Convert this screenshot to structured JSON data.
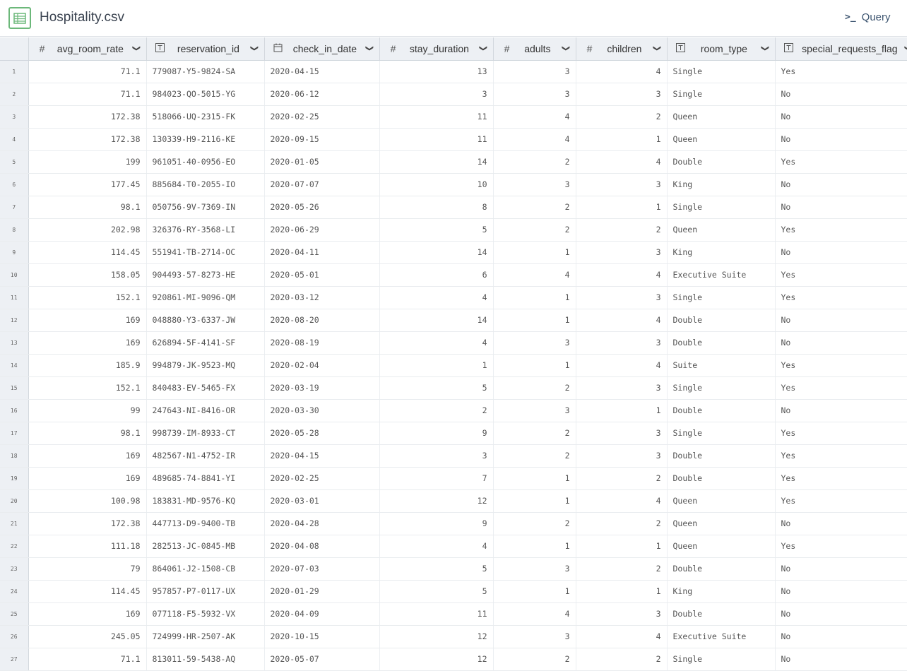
{
  "app": {
    "title": "Hospitality.csv",
    "query_label": "Query"
  },
  "columns": [
    {
      "name": "avg_room_rate",
      "type": "number",
      "icon": "#"
    },
    {
      "name": "reservation_id",
      "type": "text",
      "icon": "T"
    },
    {
      "name": "check_in_date",
      "type": "date",
      "icon": "📅"
    },
    {
      "name": "stay_duration",
      "type": "number",
      "icon": "#"
    },
    {
      "name": "adults",
      "type": "number",
      "icon": "#"
    },
    {
      "name": "children",
      "type": "number",
      "icon": "#"
    },
    {
      "name": "room_type",
      "type": "text",
      "icon": "T"
    },
    {
      "name": "special_requests_flag",
      "type": "text",
      "icon": "T"
    }
  ],
  "rows": [
    [
      "1",
      "71.1",
      "779087-Y5-9824-SA",
      "2020-04-15",
      "13",
      "3",
      "4",
      "Single",
      "Yes"
    ],
    [
      "2",
      "71.1",
      "984023-QO-5015-YG",
      "2020-06-12",
      "3",
      "3",
      "3",
      "Single",
      "No"
    ],
    [
      "3",
      "172.38",
      "518066-UQ-2315-FK",
      "2020-02-25",
      "11",
      "4",
      "2",
      "Queen",
      "No"
    ],
    [
      "4",
      "172.38",
      "130339-H9-2116-KE",
      "2020-09-15",
      "11",
      "4",
      "1",
      "Queen",
      "No"
    ],
    [
      "5",
      "199",
      "961051-40-0956-EO",
      "2020-01-05",
      "14",
      "2",
      "4",
      "Double",
      "Yes"
    ],
    [
      "6",
      "177.45",
      "885684-T0-2055-IO",
      "2020-07-07",
      "10",
      "3",
      "3",
      "King",
      "No"
    ],
    [
      "7",
      "98.1",
      "050756-9V-7369-IN",
      "2020-05-26",
      "8",
      "2",
      "1",
      "Single",
      "No"
    ],
    [
      "8",
      "202.98",
      "326376-RY-3568-LI",
      "2020-06-29",
      "5",
      "2",
      "2",
      "Queen",
      "Yes"
    ],
    [
      "9",
      "114.45",
      "551941-TB-2714-OC",
      "2020-04-11",
      "14",
      "1",
      "3",
      "King",
      "No"
    ],
    [
      "10",
      "158.05",
      "904493-57-8273-HE",
      "2020-05-01",
      "6",
      "4",
      "4",
      "Executive Suite",
      "Yes"
    ],
    [
      "11",
      "152.1",
      "920861-MI-9096-QM",
      "2020-03-12",
      "4",
      "1",
      "3",
      "Single",
      "Yes"
    ],
    [
      "12",
      "169",
      "048880-Y3-6337-JW",
      "2020-08-20",
      "14",
      "1",
      "4",
      "Double",
      "No"
    ],
    [
      "13",
      "169",
      "626894-5F-4141-SF",
      "2020-08-19",
      "4",
      "3",
      "3",
      "Double",
      "No"
    ],
    [
      "14",
      "185.9",
      "994879-JK-9523-MQ",
      "2020-02-04",
      "1",
      "1",
      "4",
      "Suite",
      "Yes"
    ],
    [
      "15",
      "152.1",
      "840483-EV-5465-FX",
      "2020-03-19",
      "5",
      "2",
      "3",
      "Single",
      "Yes"
    ],
    [
      "16",
      "99",
      "247643-NI-8416-OR",
      "2020-03-30",
      "2",
      "3",
      "1",
      "Double",
      "No"
    ],
    [
      "17",
      "98.1",
      "998739-IM-8933-CT",
      "2020-05-28",
      "9",
      "2",
      "3",
      "Single",
      "Yes"
    ],
    [
      "18",
      "169",
      "482567-N1-4752-IR",
      "2020-04-15",
      "3",
      "2",
      "3",
      "Double",
      "Yes"
    ],
    [
      "19",
      "169",
      "489685-74-8841-YI",
      "2020-02-25",
      "7",
      "1",
      "2",
      "Double",
      "Yes"
    ],
    [
      "20",
      "100.98",
      "183831-MD-9576-KQ",
      "2020-03-01",
      "12",
      "1",
      "4",
      "Queen",
      "Yes"
    ],
    [
      "21",
      "172.38",
      "447713-D9-9400-TB",
      "2020-04-28",
      "9",
      "2",
      "2",
      "Queen",
      "No"
    ],
    [
      "22",
      "111.18",
      "282513-JC-0845-MB",
      "2020-04-08",
      "4",
      "1",
      "1",
      "Queen",
      "Yes"
    ],
    [
      "23",
      "79",
      "864061-J2-1508-CB",
      "2020-07-03",
      "5",
      "3",
      "2",
      "Double",
      "No"
    ],
    [
      "24",
      "114.45",
      "957857-P7-0117-UX",
      "2020-01-29",
      "5",
      "1",
      "1",
      "King",
      "No"
    ],
    [
      "25",
      "169",
      "077118-F5-5932-VX",
      "2020-04-09",
      "11",
      "4",
      "3",
      "Double",
      "No"
    ],
    [
      "26",
      "245.05",
      "724999-HR-2507-AK",
      "2020-10-15",
      "12",
      "3",
      "4",
      "Executive Suite",
      "No"
    ],
    [
      "27",
      "71.1",
      "813011-59-5438-AQ",
      "2020-05-07",
      "12",
      "2",
      "2",
      "Single",
      "No"
    ]
  ]
}
